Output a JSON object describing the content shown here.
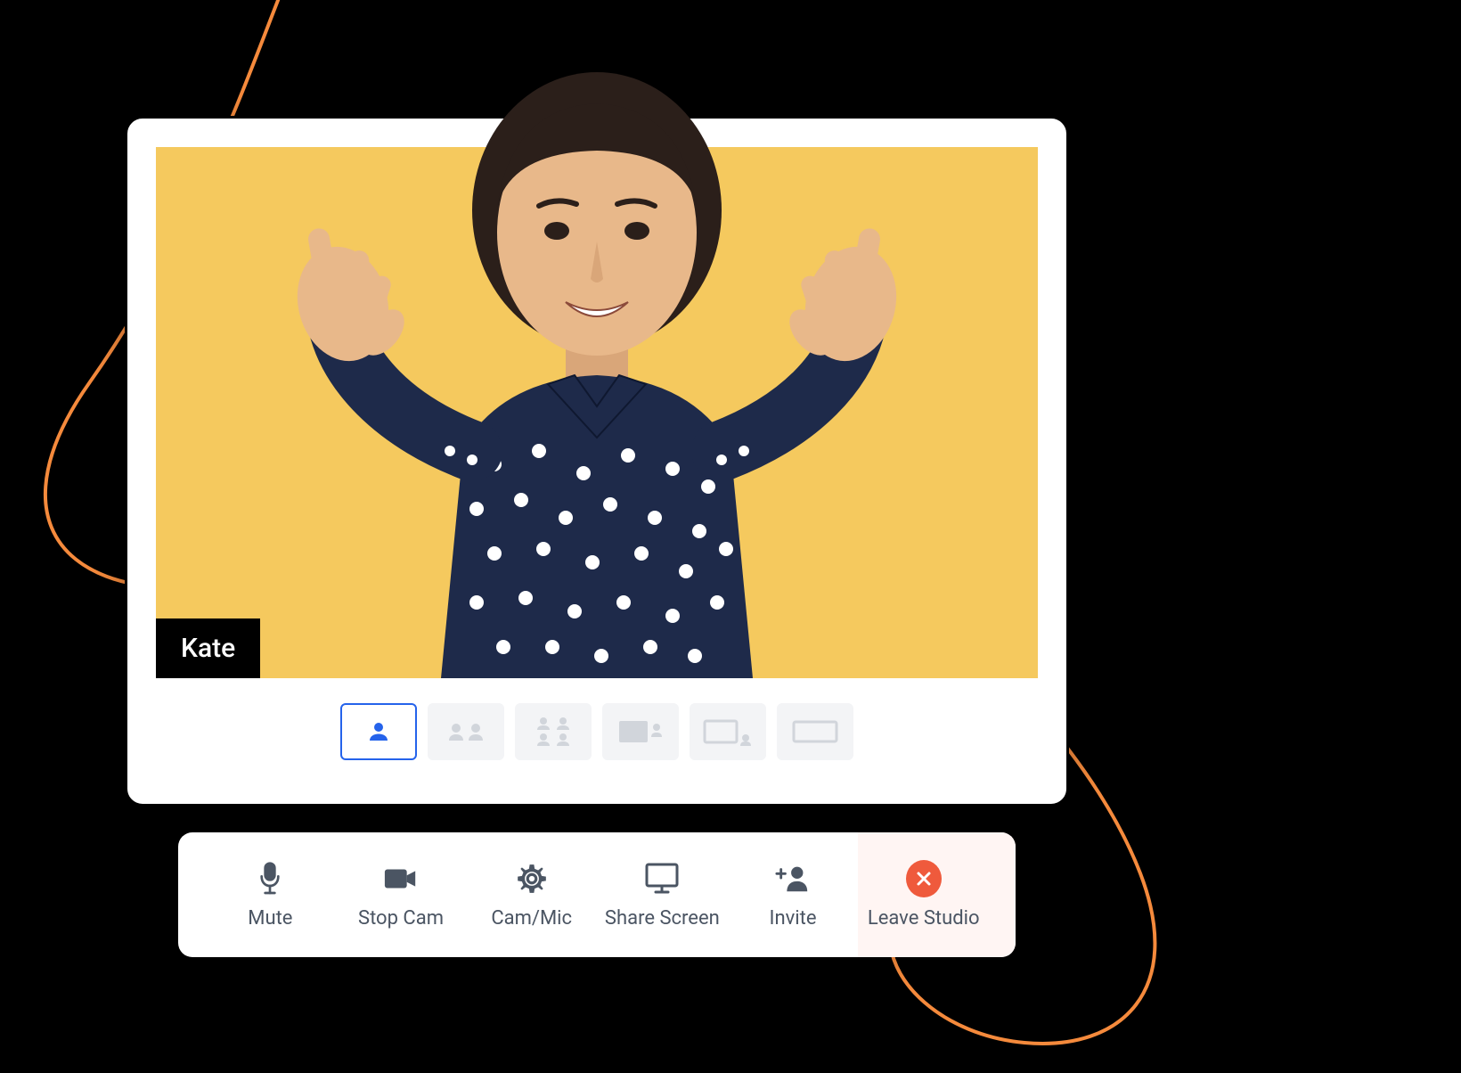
{
  "participant": {
    "name": "Kate"
  },
  "layout": {
    "activeIndex": 0,
    "optionCount": 6
  },
  "toolbar": {
    "mute": {
      "label": "Mute"
    },
    "stopCam": {
      "label": "Stop Cam"
    },
    "camMic": {
      "label": "Cam/Mic"
    },
    "shareScreen": {
      "label": "Share Screen"
    },
    "invite": {
      "label": "Invite"
    },
    "leave": {
      "label": "Leave Studio"
    }
  },
  "colors": {
    "accent": "#2563EB",
    "videoBackground": "#F5C95E",
    "leaveAccent": "#EF5A3C",
    "iconGray": "#6B7280"
  }
}
